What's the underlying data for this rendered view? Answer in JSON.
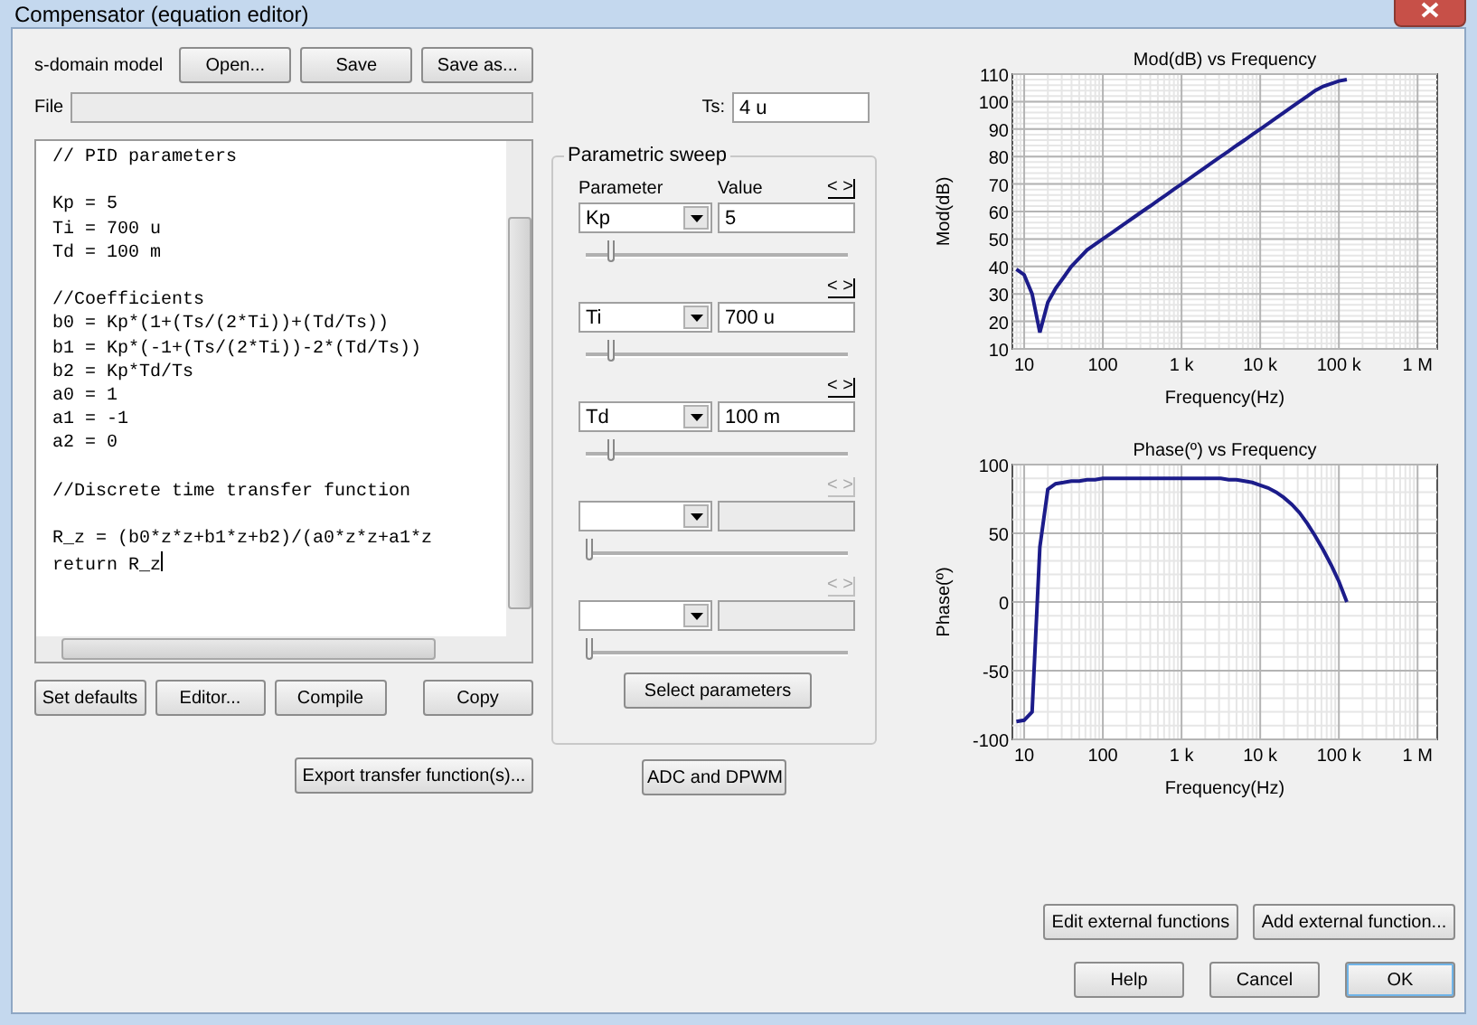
{
  "window": {
    "title": "Compensator (equation editor)"
  },
  "model": {
    "label": "s-domain model",
    "buttons": [
      "Open...",
      "Save",
      "Save as..."
    ]
  },
  "file": {
    "label": "File"
  },
  "ts": {
    "label": "Ts:",
    "value": "4 u"
  },
  "editor": {
    "code": "// PID parameters\n\nKp = 5\nTi = 700 u\nTd = 100 m\n\n//Coefficients\nb0 = Kp*(1+(Ts/(2*Ti))+(Td/Ts))\nb1 = Kp*(-1+(Ts/(2*Ti))-2*(Td/Ts))\nb2 = Kp*Td/Ts\na0 = 1\na1 = -1\na2 = 0\n\n//Discrete time transfer function\n\nR_z = (b0*z*z+b1*z+b2)/(a0*z*z+a1*z\nreturn R_z"
  },
  "editor_buttons": [
    "Set defaults",
    "Editor...",
    "Compile",
    "Copy"
  ],
  "export_button": "Export transfer function(s)...",
  "sweep": {
    "title": "Parametric sweep",
    "parameter_header": "Parameter",
    "value_header": "Value",
    "rows": [
      {
        "step_button": "< >",
        "parameter": "Kp",
        "value": "5",
        "level": 0.08,
        "disabled": false
      },
      {
        "step_button": "< >",
        "parameter": "Ti",
        "value": "700 u",
        "level": 0.08,
        "disabled": false
      },
      {
        "step_button": "< >",
        "parameter": "Td",
        "value": "100 m",
        "level": 0.08,
        "disabled": false
      },
      {
        "step_button": "< >",
        "level": 0,
        "disabled": true
      },
      {
        "step_button": "< >",
        "level": 0,
        "disabled": true
      }
    ],
    "select_button": "Select parameters"
  },
  "adc_button": "ADC and DPWM",
  "charts": [
    {
      "chart_data": {
        "type": "line",
        "title": "Mod(dB) vs Frequency",
        "xlabel": "Frequency(Hz)",
        "ylabel": "Mod(dB)",
        "categories": [
          null,
          "10",
          null,
          null,
          null,
          null,
          null,
          null,
          null,
          null,
          null,
          "100",
          null,
          null,
          null,
          null,
          null,
          null,
          null,
          null,
          null,
          "1 k",
          null,
          null,
          null,
          null,
          null,
          null,
          null,
          null,
          null,
          "10 k",
          null,
          null,
          null,
          null,
          null,
          null,
          null,
          null,
          null,
          "100 k",
          null,
          null,
          null,
          null,
          null,
          null,
          null,
          null,
          null,
          "1 M",
          null,
          null
        ],
        "series": [
          {
            "color": "#1c1c8a",
            "values": [
              39,
              37,
              30,
              16,
              27,
              32,
              36,
              40,
              43,
              46,
              48,
              50,
              52,
              54,
              56,
              58,
              60,
              62,
              64,
              66,
              68,
              70,
              72,
              74,
              76,
              78,
              80,
              82,
              84,
              86,
              88,
              90,
              92,
              94,
              96,
              98,
              100,
              102,
              104,
              105.5,
              106.5,
              107.5,
              108,
              null,
              null,
              null,
              null,
              null,
              null,
              null,
              null,
              null,
              null,
              null
            ]
          }
        ],
        "ylim": [
          10,
          110
        ],
        "yticks": [
          10,
          20,
          30,
          40,
          50,
          60,
          70,
          80,
          90,
          100,
          110
        ],
        "grid": true
      }
    },
    {
      "chart_data": {
        "type": "line",
        "title": "Phase(º) vs Frequency",
        "xlabel": "Frequency(Hz)",
        "ylabel": "Phase(º)",
        "categories": [
          null,
          "10",
          null,
          null,
          null,
          null,
          null,
          null,
          null,
          null,
          null,
          "100",
          null,
          null,
          null,
          null,
          null,
          null,
          null,
          null,
          null,
          "1 k",
          null,
          null,
          null,
          null,
          null,
          null,
          null,
          null,
          null,
          "10 k",
          null,
          null,
          null,
          null,
          null,
          null,
          null,
          null,
          null,
          "100 k",
          null,
          null,
          null,
          null,
          null,
          null,
          null,
          null,
          null,
          "1 M",
          null,
          null
        ],
        "series": [
          {
            "color": "#1c1c8a",
            "values": [
              -87,
              -86,
              -80,
              40,
              82,
              86,
              87,
              88,
              88,
              89,
              89,
              90,
              90,
              90,
              90,
              90,
              90,
              90,
              90,
              90,
              90,
              90,
              90,
              90,
              90,
              90,
              90,
              89,
              89,
              88,
              87,
              85,
              83,
              80,
              76,
              71,
              65,
              57,
              48,
              38,
              27,
              15,
              0,
              null,
              null,
              null,
              null,
              null,
              null,
              null,
              null,
              null,
              null,
              null
            ]
          }
        ],
        "ylim": [
          -100,
          100
        ],
        "yticks": [
          -100,
          -50,
          0,
          50,
          100
        ],
        "grid": true
      }
    }
  ],
  "external_buttons": [
    "Edit external functions",
    "Add external function..."
  ],
  "dialog_buttons": [
    "Help",
    "Cancel",
    "OK"
  ]
}
